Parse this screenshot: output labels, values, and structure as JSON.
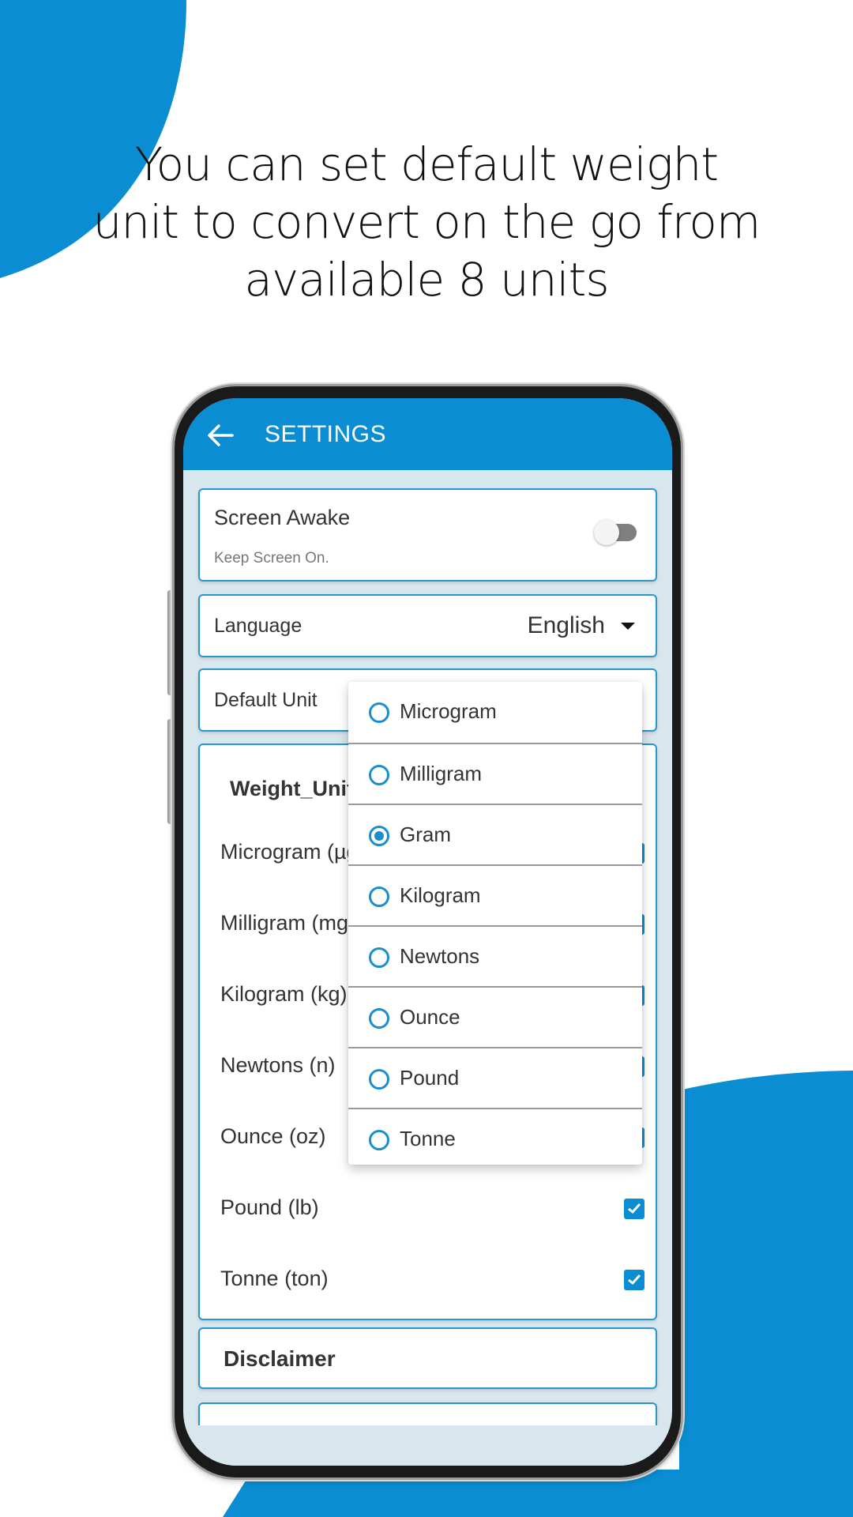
{
  "promo": {
    "headline_lines": [
      "You can set default weight",
      "unit to convert on the go from",
      "available 8 units"
    ],
    "accent_color": "#0a8dd2"
  },
  "appbar": {
    "back_icon": "arrow-left-icon",
    "title": "SETTINGS"
  },
  "settings": {
    "screen_awake": {
      "title": "Screen Awake",
      "subtitle": "Keep Screen On.",
      "enabled": false
    },
    "language": {
      "label": "Language",
      "value": "English"
    },
    "default_unit": {
      "label": "Default Unit",
      "selected": "Gram"
    },
    "weight_units": {
      "title": "Weight_Units",
      "items": [
        {
          "label": "Microgram (µg)",
          "checked": true
        },
        {
          "label": "Milligram (mg)",
          "checked": true
        },
        {
          "label": "Kilogram (kg)",
          "checked": true
        },
        {
          "label": "Newtons (n)",
          "checked": true
        },
        {
          "label": "Ounce (oz)",
          "checked": true
        },
        {
          "label": "Pound (lb)",
          "checked": true
        },
        {
          "label": "Tonne (ton)",
          "checked": true
        }
      ]
    },
    "disclaimer": {
      "title": "Disclaimer"
    }
  },
  "dropdown": {
    "options": [
      {
        "label": "Microgram",
        "selected": false
      },
      {
        "label": "Milligram",
        "selected": false
      },
      {
        "label": "Gram",
        "selected": true
      },
      {
        "label": "Kilogram",
        "selected": false
      },
      {
        "label": "Newtons",
        "selected": false
      },
      {
        "label": "Ounce",
        "selected": false
      },
      {
        "label": "Pound",
        "selected": false
      },
      {
        "label": "Tonne",
        "selected": false
      }
    ]
  }
}
